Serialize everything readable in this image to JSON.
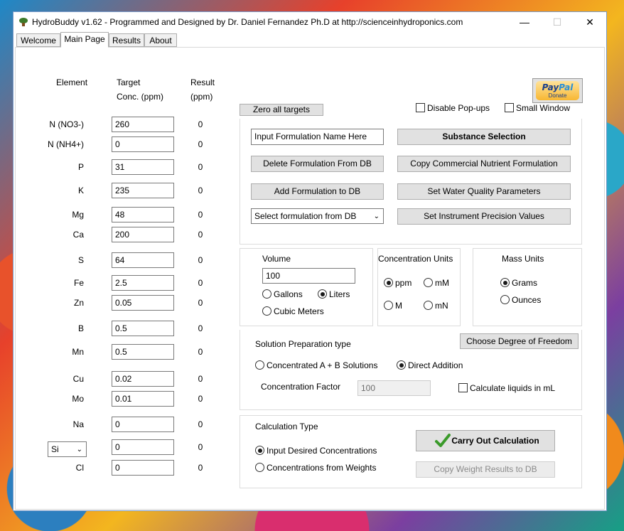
{
  "window": {
    "title": "HydroBuddy v1.62 - Programmed and Designed by Dr. Daniel Fernandez Ph.D at http://scienceinhydroponics.com"
  },
  "tabs": [
    "Welcome",
    "Main Page",
    "Results",
    "About"
  ],
  "headers": {
    "element": "Element",
    "target1": "Target",
    "target2": "Conc. (ppm)",
    "result1": "Result",
    "result2": "(ppm)"
  },
  "elements": [
    {
      "name": "N (NO3-)",
      "target": "260",
      "result": "0"
    },
    {
      "name": "N (NH4+)",
      "target": "0",
      "result": "0"
    },
    {
      "name": "P",
      "target": "31",
      "result": "0"
    },
    {
      "name": "K",
      "target": "235",
      "result": "0"
    },
    {
      "name": "Mg",
      "target": "48",
      "result": "0"
    },
    {
      "name": "Ca",
      "target": "200",
      "result": "0"
    },
    {
      "name": "S",
      "target": "64",
      "result": "0"
    },
    {
      "name": "Fe",
      "target": "2.5",
      "result": "0"
    },
    {
      "name": "Zn",
      "target": "0.05",
      "result": "0"
    },
    {
      "name": "B",
      "target": "0.5",
      "result": "0"
    },
    {
      "name": "Mn",
      "target": "0.5",
      "result": "0"
    },
    {
      "name": "Cu",
      "target": "0.02",
      "result": "0"
    },
    {
      "name": "Mo",
      "target": "0.01",
      "result": "0"
    },
    {
      "name": "Na",
      "target": "0",
      "result": "0"
    },
    {
      "name": "Si",
      "target": "0",
      "result": "0"
    },
    {
      "name": "Cl",
      "target": "0",
      "result": "0"
    }
  ],
  "buttons": {
    "zero_targets": "Zero all targets",
    "substance_selection": "Substance Selection",
    "delete_formulation": "Delete Formulation From DB",
    "copy_commercial": "Copy Commercial Nutrient Formulation",
    "add_formulation": "Add Formulation to DB",
    "water_quality": "Set Water Quality Parameters",
    "instrument_precision": "Set Instrument Precision Values",
    "degree_freedom": "Choose Degree of Freedom",
    "carry_out": "Carry Out Calculation",
    "copy_weight": "Copy Weight Results to DB"
  },
  "paypal": {
    "pay": "Pay",
    "pal": "Pal",
    "donate": "Donate"
  },
  "options": {
    "disable_popups": "Disable Pop-ups",
    "small_window": "Small Window"
  },
  "formulation": {
    "name_value": "Input Formulation Name Here",
    "select_value": "Select formulation from DB"
  },
  "volume": {
    "label": "Volume",
    "value": "100",
    "gallons": "Gallons",
    "liters": "Liters",
    "cubic": "Cubic Meters"
  },
  "conc_units": {
    "label": "Concentration Units",
    "ppm": "ppm",
    "mM": "mM",
    "M": "M",
    "mN": "mN"
  },
  "mass_units": {
    "label": "Mass Units",
    "grams": "Grams",
    "ounces": "Ounces"
  },
  "solution": {
    "label": "Solution Preparation type",
    "ab": "Concentrated A + B Solutions",
    "direct": "Direct Addition",
    "factor_label": "Concentration Factor",
    "factor_value": "100",
    "liquids_ml": "Calculate liquids in mL"
  },
  "calc_type": {
    "label": "Calculation Type",
    "input": "Input Desired Concentrations",
    "weights": "Concentrations from  Weights"
  }
}
